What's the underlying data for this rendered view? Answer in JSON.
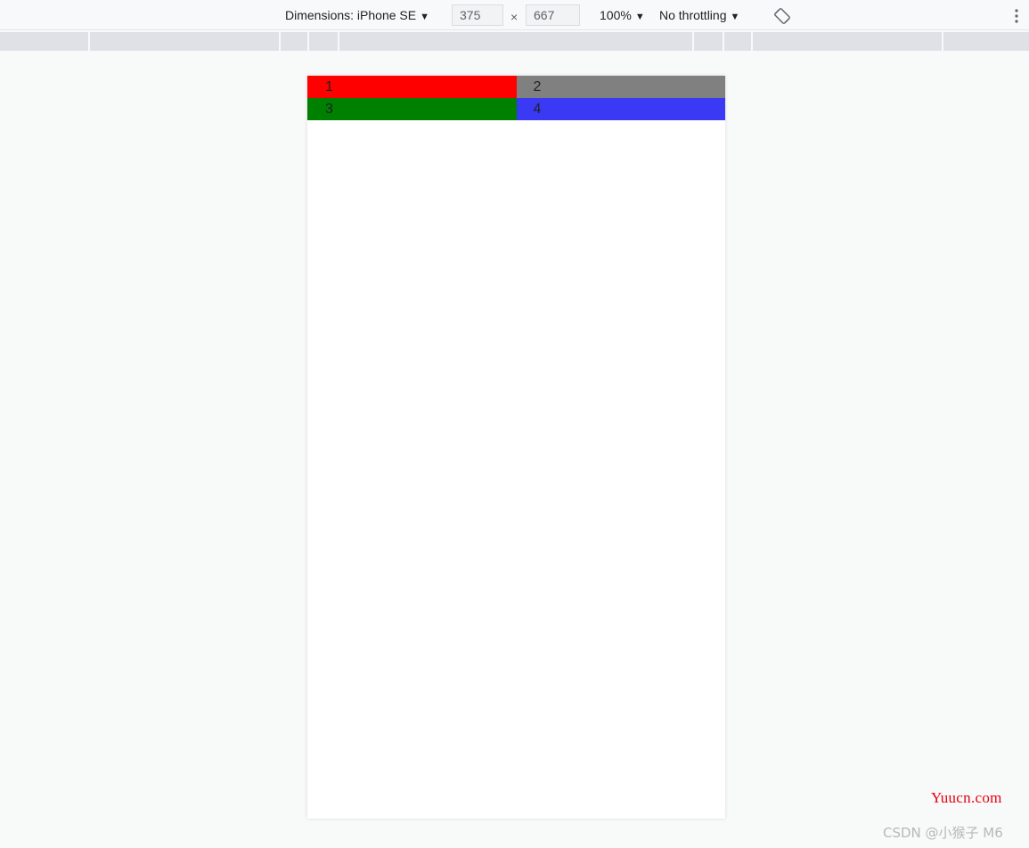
{
  "toolbar": {
    "dimensions_label": "Dimensions: iPhone SE",
    "width_value": "375",
    "times": "×",
    "height_value": "667",
    "zoom_label": "100%",
    "throttling_label": "No throttling",
    "caret": "▼",
    "rotate_icon": "rotate-icon",
    "more_icon": "more-vert-icon"
  },
  "grid": {
    "cells": [
      {
        "label": "1",
        "color": "#ff0000"
      },
      {
        "label": "2",
        "color": "#808080"
      },
      {
        "label": "3",
        "color": "#008000"
      },
      {
        "label": "4",
        "color": "#3a3af5"
      }
    ]
  },
  "watermarks": {
    "yuucn": "Yuucn.com",
    "csdn": "CSDN @小猴子 M6"
  }
}
